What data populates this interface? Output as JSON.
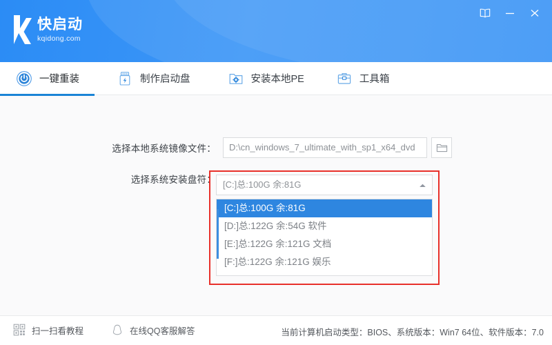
{
  "window": {
    "brand_cn": "快启动",
    "brand_domain": "kqidong.com",
    "controls": [
      {
        "name": "help-book-icon",
        "label": "帮助"
      },
      {
        "name": "minimize-icon",
        "label": "最小化"
      },
      {
        "name": "close-icon",
        "label": "关闭"
      }
    ]
  },
  "tabs": [
    {
      "label": "一键重装",
      "icon": "power-icon",
      "active": true
    },
    {
      "label": "制作启动盘",
      "icon": "usb-drive-icon",
      "active": false
    },
    {
      "label": "安装本地PE",
      "icon": "folder-gear-icon",
      "active": false
    },
    {
      "label": "工具箱",
      "icon": "toolbox-icon",
      "active": false
    }
  ],
  "form": {
    "iso": {
      "label": "选择本地系统镜像文件：",
      "value": "D:\\cn_windows_7_ultimate_with_sp1_x64_dvd",
      "browse_icon": "folder-icon"
    },
    "drive": {
      "label": "选择系统安装盘符：",
      "value": "[C:]总:100G 余:81G",
      "arrow_icon": "chevron-up-icon",
      "options": [
        {
          "text": "[C:]总:100G 余:81G",
          "selected": true
        },
        {
          "text": "[D:]总:122G 余:54G 软件",
          "selected": false
        },
        {
          "text": "[E:]总:122G 余:121G 文档",
          "selected": false
        },
        {
          "text": "[F:]总:122G 余:121G 娱乐",
          "selected": false
        }
      ]
    },
    "highlight_color": "#e8302a"
  },
  "footer": {
    "qr": {
      "label": "扫一扫看教程",
      "icon": "qr-code-icon"
    },
    "qq": {
      "label": "在线QQ客服解答",
      "icon": "qq-penguin-icon"
    },
    "status": "当前计算机启动类型：BIOS、系统版本：Win7 64位、软件版本：7.0"
  },
  "colors": {
    "brand_blue": "#2f8ef6",
    "accent_blue": "#1a84d6",
    "select_blue": "#2e86e0",
    "alert_red": "#e8302a"
  }
}
